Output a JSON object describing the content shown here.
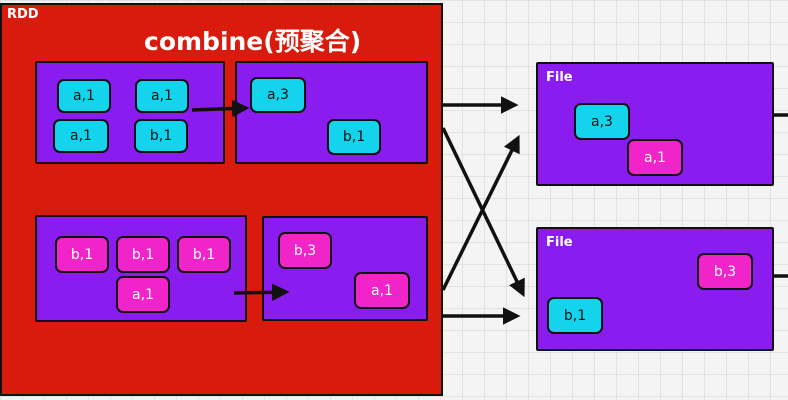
{
  "rdd": {
    "label": "RDD",
    "title": "combine(预聚合)"
  },
  "partitions": [
    {
      "before": [
        {
          "text": "a,1",
          "color": "cyan"
        },
        {
          "text": "a,1",
          "color": "cyan"
        },
        {
          "text": "a,1",
          "color": "cyan"
        },
        {
          "text": "b,1",
          "color": "cyan"
        }
      ],
      "after": [
        {
          "text": "a,3",
          "color": "cyan"
        },
        {
          "text": "b,1",
          "color": "cyan"
        }
      ]
    },
    {
      "before": [
        {
          "text": "b,1",
          "color": "pink"
        },
        {
          "text": "b,1",
          "color": "pink"
        },
        {
          "text": "b,1",
          "color": "pink"
        },
        {
          "text": "a,1",
          "color": "pink"
        }
      ],
      "after": [
        {
          "text": "b,3",
          "color": "pink"
        },
        {
          "text": "a,1",
          "color": "pink"
        }
      ]
    }
  ],
  "files": [
    {
      "label": "File",
      "items": [
        {
          "text": "a,3",
          "color": "cyan"
        },
        {
          "text": "a,1",
          "color": "pink"
        }
      ]
    },
    {
      "label": "File",
      "items": [
        {
          "text": "b,3",
          "color": "pink"
        },
        {
          "text": "b,1",
          "color": "cyan"
        }
      ]
    }
  ],
  "colors": {
    "rdd": "#d81b0c",
    "box": "#8a1cf0",
    "cyan": "#13d4ec",
    "pink": "#f024c8"
  }
}
